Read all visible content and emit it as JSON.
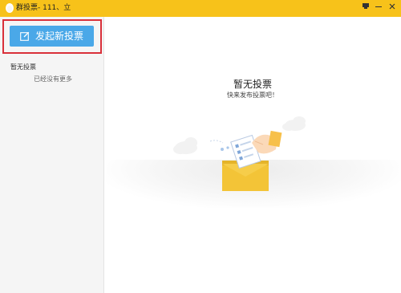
{
  "window": {
    "title": "群投票-  111、立"
  },
  "sidebar": {
    "new_vote_button": "发起新投票",
    "heading": "暂无投票",
    "no_more": "已经没有更多"
  },
  "main": {
    "empty_title": "暂无投票",
    "empty_subtitle": "快来发布投票吧！"
  },
  "colors": {
    "titlebar": "#f7c21a",
    "button": "#4aa8e8",
    "highlight": "#d9303a",
    "envelope": "#f3c437"
  },
  "icons": [
    "qq-penguin-icon",
    "pin-icon",
    "minimize-icon",
    "close-icon",
    "edit-icon",
    "cloud-icon",
    "envelope-icon",
    "hand-icon"
  ]
}
